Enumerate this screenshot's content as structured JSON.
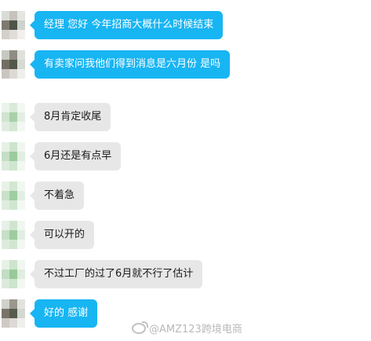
{
  "chat": {
    "messages": [
      {
        "text": "经理 您好 今年招商大概什么时候结束",
        "style": "blue"
      },
      {
        "text": "有卖家问我他们得到消息是六月份 是吗",
        "style": "blue"
      },
      {
        "text": "8月肯定收尾",
        "style": "gray"
      },
      {
        "text": "6月还是有点早",
        "style": "gray"
      },
      {
        "text": "不着急",
        "style": "gray"
      },
      {
        "text": "可以开的",
        "style": "gray"
      },
      {
        "text": "不过工厂的过了6月就不行了估计",
        "style": "gray"
      },
      {
        "text": "好的 感谢",
        "style": "blue"
      }
    ]
  },
  "watermark": {
    "text": "@AMZ123跨境电商",
    "icon": "weibo-icon"
  },
  "colors": {
    "blue_bubble": "#18b5f3",
    "gray_bubble": "#e7e7e7"
  }
}
